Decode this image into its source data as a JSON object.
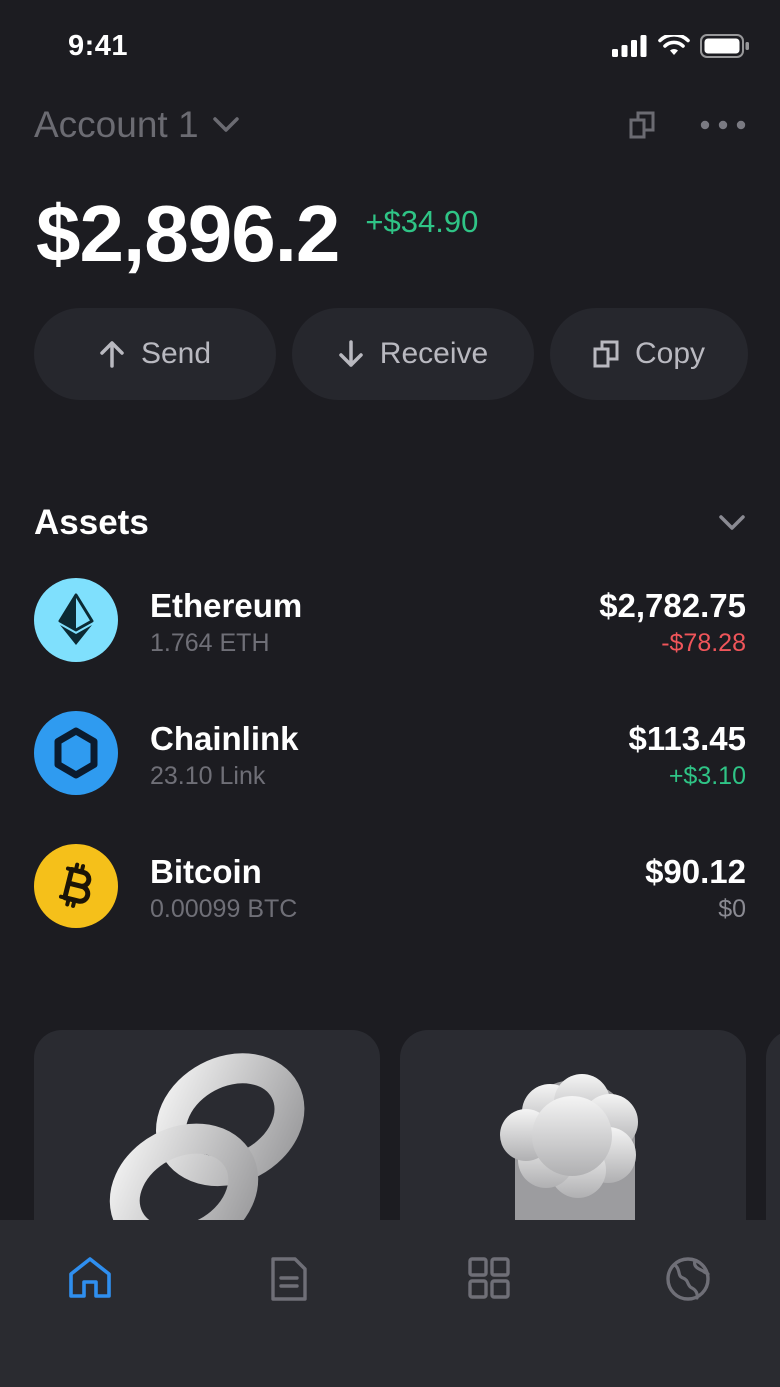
{
  "status_bar": {
    "time": "9:41"
  },
  "header": {
    "account_name": "Account 1"
  },
  "balance": {
    "total": "$2,896.2",
    "change": "+$34.90"
  },
  "actions": [
    {
      "label": "Send",
      "icon": "arrow-up-icon"
    },
    {
      "label": "Receive",
      "icon": "arrow-down-icon"
    },
    {
      "label": "Copy",
      "icon": "copy-icon"
    }
  ],
  "assets": {
    "title": "Assets",
    "items": [
      {
        "name": "Ethereum",
        "amount": "1.764 ETH",
        "value": "$2,782.75",
        "delta": "-$78.28",
        "icon": "ethereum-icon",
        "color": "#7fe0fd"
      },
      {
        "name": "Chainlink",
        "amount": "23.10 Link",
        "value": "$113.45",
        "delta": "+$3.10",
        "icon": "chainlink-icon",
        "color": "#2f9bf0"
      },
      {
        "name": "Bitcoin",
        "amount": "0.00099 BTC",
        "value": "$90.12",
        "delta": "$0",
        "icon": "bitcoin-icon",
        "color": "#f5c01a"
      }
    ]
  },
  "tab_bar": {
    "tabs": [
      {
        "name": "home",
        "icon": "home-icon",
        "active": true
      },
      {
        "name": "activity",
        "icon": "document-icon",
        "active": false
      },
      {
        "name": "apps",
        "icon": "grid-icon",
        "active": false
      },
      {
        "name": "browser",
        "icon": "globe-icon",
        "active": false
      }
    ]
  },
  "colors": {
    "accent": "#2f8fef",
    "positive": "#2fc486",
    "negative": "#f0555a",
    "background": "#1c1c21"
  }
}
